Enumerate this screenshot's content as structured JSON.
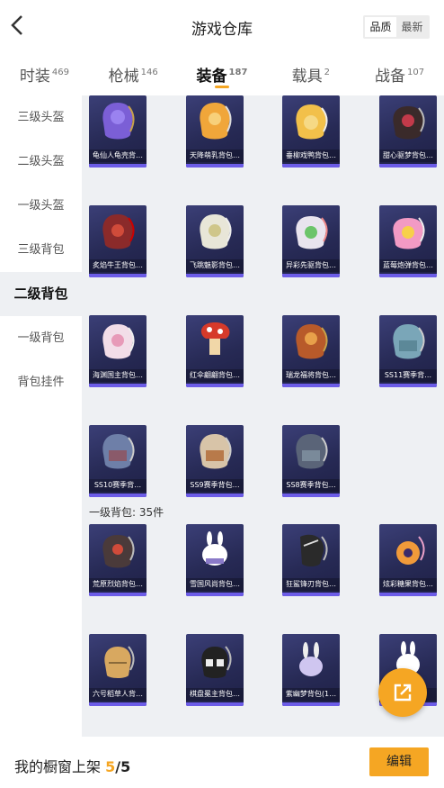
{
  "header": {
    "title": "游戏仓库",
    "sort_options": [
      "品质",
      "最新"
    ],
    "sort_selected": "品质"
  },
  "tabs": [
    {
      "label": "时装",
      "count": "469"
    },
    {
      "label": "枪械",
      "count": "146"
    },
    {
      "label": "装备",
      "count": "187",
      "active": true
    },
    {
      "label": "载具",
      "count": "2"
    },
    {
      "label": "战备",
      "count": "107"
    }
  ],
  "sidebar": {
    "items": [
      {
        "label": "三级头盔"
      },
      {
        "label": "二级头盔"
      },
      {
        "label": "一级头盔"
      },
      {
        "label": "三级背包"
      },
      {
        "label": "二级背包",
        "active": true
      },
      {
        "label": "一级背包"
      },
      {
        "label": "背包挂件"
      }
    ]
  },
  "grid": {
    "rows": [
      [
        "龟仙人龟壳背…",
        "天降萌乳背包…",
        "垂柳戏鸭背包…",
        "甜心驱梦背包…"
      ],
      [
        "炙焰牛王背包…",
        "飞跳魅影背包…",
        "异彩先驱背包…",
        "蓝莓炮弹背包…"
      ],
      [
        "海渊国主背包…",
        "红伞翩翩背包…",
        "瑞龙福将背包…",
        "SS11赛季背…"
      ],
      [
        "SS10赛季背…",
        "SS9赛季背包…",
        "SS8赛季背包…"
      ],
      [
        "荒原烈焰背包…",
        "雪国风尚背包…",
        "狂鲨锋刃背包…",
        "炫彩糖果背包…"
      ],
      [
        "六号稻草人背…",
        "棋盘冕主背包…",
        "紫幽梦背包(1…",
        ""
      ]
    ],
    "section_heading": "一级背包: 35件"
  },
  "icons": {
    "back": "chevron-left-icon",
    "fab": "external-share-icon"
  },
  "bottom_bar": {
    "label": "我的橱窗上架",
    "current": "5",
    "separator": "/",
    "total": "5",
    "edit_label": "编辑"
  },
  "colors": {
    "accent": "#f5a623",
    "card_bg": "#2c2f5e",
    "card_strip": "#6c5ce7",
    "panel_bg": "#eef0f3"
  }
}
